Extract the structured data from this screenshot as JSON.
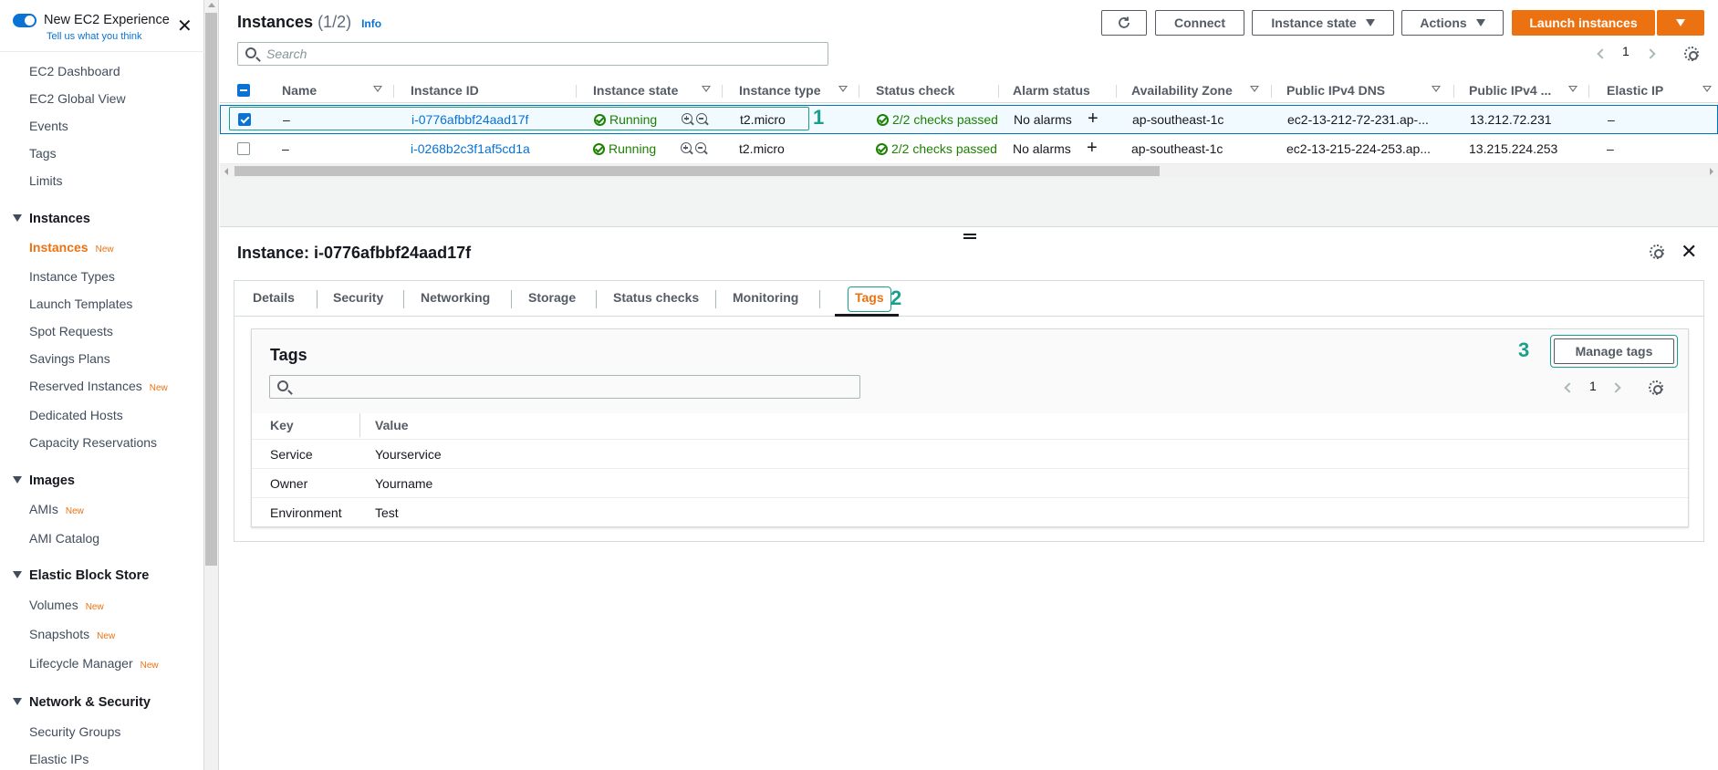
{
  "sidebar": {
    "experience_title": "New EC2 Experience",
    "experience_link": "Tell us what you think",
    "new_badge": "New",
    "top_items": [
      "EC2 Dashboard",
      "EC2 Global View",
      "Events",
      "Tags",
      "Limits"
    ],
    "sections": {
      "instances": {
        "title": "Instances",
        "items": [
          "Instances",
          "Instance Types",
          "Launch Templates",
          "Spot Requests",
          "Savings Plans",
          "Reserved Instances",
          "Dedicated Hosts",
          "Capacity Reservations"
        ]
      },
      "images": {
        "title": "Images",
        "items": [
          "AMIs",
          "AMI Catalog"
        ]
      },
      "ebs": {
        "title": "Elastic Block Store",
        "items": [
          "Volumes",
          "Snapshots",
          "Lifecycle Manager"
        ]
      },
      "network": {
        "title": "Network & Security",
        "items": [
          "Security Groups",
          "Elastic IPs"
        ]
      }
    }
  },
  "header": {
    "title": "Instances",
    "count": "(1/2)",
    "info": "Info",
    "connect": "Connect",
    "instance_state": "Instance state",
    "actions": "Actions",
    "launch": "Launch instances",
    "search_placeholder": "Search",
    "page": "1"
  },
  "table": {
    "columns": [
      "Name",
      "Instance ID",
      "Instance state",
      "Instance type",
      "Status check",
      "Alarm status",
      "Availability Zone",
      "Public IPv4 DNS",
      "Public IPv4 ...",
      "Elastic IP"
    ],
    "rows": [
      {
        "name": "–",
        "id": "i-0776afbbf24aad17f",
        "state": "Running",
        "type": "t2.micro",
        "status": "2/2 checks passed",
        "alarm": "No alarms",
        "az": "ap-southeast-1c",
        "dns": "ec2-13-212-72-231.ap-...",
        "ip": "13.212.72.231",
        "eip": "–",
        "selected": true
      },
      {
        "name": "–",
        "id": "i-0268b2c3f1af5cd1a",
        "state": "Running",
        "type": "t2.micro",
        "status": "2/2 checks passed",
        "alarm": "No alarms",
        "az": "ap-southeast-1c",
        "dns": "ec2-13-215-224-253.ap...",
        "ip": "13.215.224.253",
        "eip": "–",
        "selected": false
      }
    ]
  },
  "detail": {
    "title": "Instance: i-0776afbbf24aad17f",
    "tabs": [
      "Details",
      "Security",
      "Networking",
      "Storage",
      "Status checks",
      "Monitoring",
      "Tags"
    ],
    "active_tab": "Tags",
    "tags": {
      "title": "Tags",
      "manage": "Manage tags",
      "page": "1",
      "key_header": "Key",
      "value_header": "Value",
      "rows": [
        {
          "key": "Service",
          "value": "Yourservice"
        },
        {
          "key": "Owner",
          "value": "Yourname"
        },
        {
          "key": "Environment",
          "value": "Test"
        }
      ]
    }
  },
  "callouts": [
    "1",
    "2",
    "3"
  ],
  "colors": {
    "accent": "#ec7211",
    "link": "#0972d3",
    "callout": "#1aa08a",
    "running": "#1d8102"
  }
}
